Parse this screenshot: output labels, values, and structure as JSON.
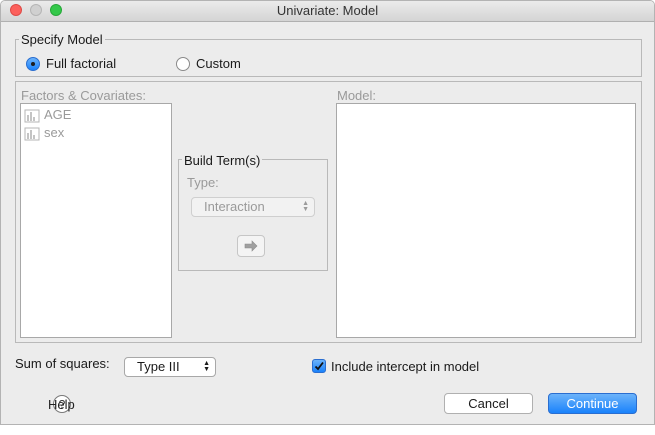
{
  "window": {
    "title": "Univariate: Model"
  },
  "specify_model": {
    "label": "Specify Model",
    "full_factorial_label": "Full factorial",
    "custom_label": "Custom",
    "selected": "Full factorial"
  },
  "factors": {
    "label": "Factors & Covariates:",
    "items": [
      {
        "label": "AGE",
        "icon": "scale-variable-icon"
      },
      {
        "label": "sex",
        "icon": "scale-variable-icon"
      }
    ]
  },
  "build_term": {
    "label": "Build Term(s)",
    "type_label": "Type:",
    "type_value": "Interaction",
    "move_icon": "right-arrow-icon"
  },
  "model": {
    "label": "Model:"
  },
  "sum_of_squares": {
    "label": "Sum of squares:",
    "value": "Type III"
  },
  "intercept": {
    "label": "Include intercept in model",
    "checked": true
  },
  "buttons": {
    "help": "Help",
    "cancel": "Cancel",
    "continue": "Continue"
  }
}
